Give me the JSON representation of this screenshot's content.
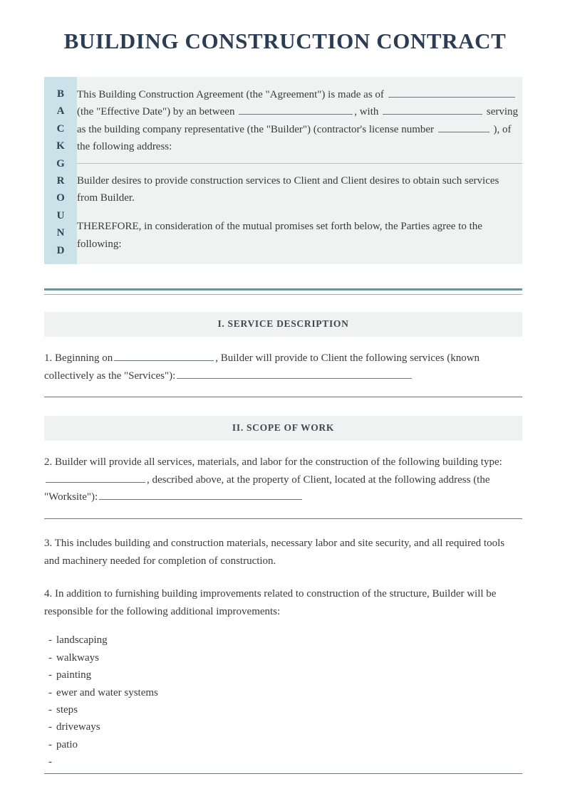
{
  "document": {
    "title": "BUILDING CONSTRUCTION CONTRACT",
    "accent_teal": "#4f9fa8",
    "sidebar_blue": "#cbe2e9",
    "panel_gray": "#eef2f1",
    "title_navy": "#2a3d54"
  },
  "background_block": {
    "label": "BACKGROUND",
    "label_letters": [
      "B",
      "A",
      "C",
      "K",
      "G",
      "R",
      "O",
      "U",
      "N",
      "D"
    ],
    "paragraph_1": {
      "seg_1": "This Building Construction Agreement (the \"Agreement\") is made as of",
      "seg_2": "(the \"Effective Date\") by an between",
      "seg_3": ",",
      "seg_4": "with",
      "seg_5": "serving as the building company representative (the",
      "seg_6": "\"Builder\") (contractor's license number",
      "seg_7": "), of the following address:"
    },
    "paragraph_2": "Builder desires to provide construction services to Client and Client desires to obtain such services from Builder.",
    "paragraph_3": "THEREFORE, in consideration of the mutual promises set forth below, the Parties agree to the following:"
  },
  "sections": [
    {
      "heading": "I. SERVICE DESCRIPTION",
      "paragraph": {
        "seg_1": "1. Beginning on",
        "seg_2": ", Builder will provide to Client the following services (known collectively as the \"Services\"):"
      }
    },
    {
      "heading": "II. SCOPE OF WORK",
      "clause_2": {
        "seg_1": "2. Builder will provide all services, materials, and labor for the construction of the following building type:",
        "seg_2": ", described above, at the property of Client, located at the following address (the \"Worksite\"):"
      },
      "clause_3": "3. This includes building and construction materials, necessary labor and site security, and all required tools and machinery needed for completion of construction.",
      "clause_4": "4. In addition to furnishing building improvements related to construction of the structure, Builder will be responsible for the following additional improvements:",
      "improvements": [
        "landscaping",
        "walkways",
        "painting",
        "ewer and water systems",
        "steps",
        "driveways",
        "patio"
      ],
      "improvements_blank_dash": "-"
    }
  ]
}
